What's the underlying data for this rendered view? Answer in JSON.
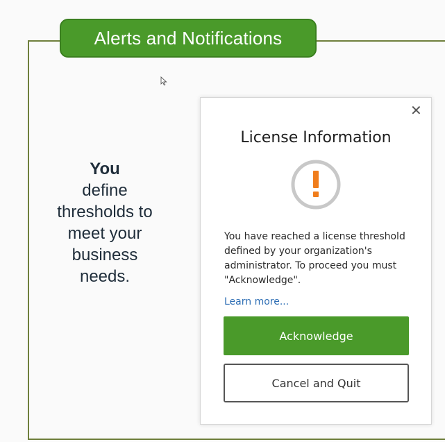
{
  "header": {
    "title": "Alerts and Notifications"
  },
  "aside": {
    "bold_line": "You",
    "body_lines": [
      "define",
      "thresholds to",
      "meet your",
      "business",
      "needs."
    ]
  },
  "dialog": {
    "title": "License Information",
    "close_icon": "close-icon",
    "status_icon": "exclamation-warning-icon",
    "message": "You have reached a license threshold defined by your organization's administrator. To proceed you must \"Acknowledge\".",
    "learn_more": "Learn more...",
    "acknowledge_label": "Acknowledge",
    "cancel_label": "Cancel and Quit"
  },
  "colors": {
    "brand_green": "#4a9a2a",
    "frame_olive": "#6e7f3c",
    "warning_orange": "#f07d1c",
    "link_blue": "#2f6fb5"
  }
}
